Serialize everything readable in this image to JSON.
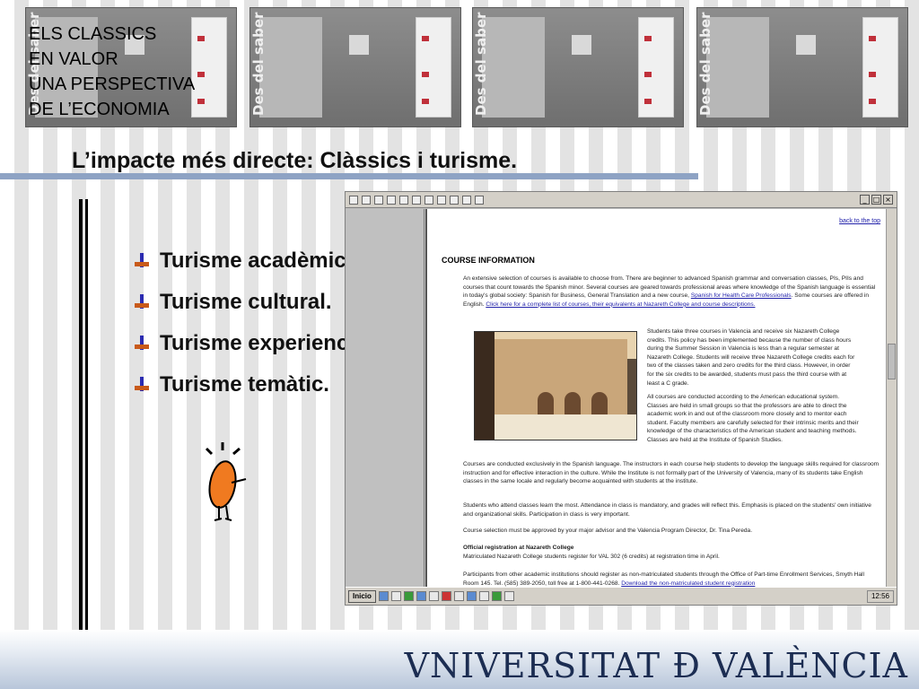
{
  "header": {
    "lines": [
      "ELS CLASSICS",
      "EN VALOR",
      "UNA PERSPECTIVA",
      "DE L’ECONOMIA"
    ]
  },
  "thumbnails": [
    {
      "caption": "Des del saber divers"
    },
    {
      "caption": "Des del saber divers"
    },
    {
      "caption": "Des del saber divers"
    },
    {
      "caption": "Des del saber divers"
    }
  ],
  "slide": {
    "title": "L’impacte més directe: Clàssics i turisme.",
    "bullets": [
      "Turisme acadèmic.",
      "Turisme cultural.",
      "Turisme experiencial.",
      "Turisme temàtic."
    ]
  },
  "browser": {
    "back_to_top": "back to the top",
    "heading": "COURSE INFORMATION",
    "p1": "An extensive selection of courses is available to choose from. There are beginner to advanced Spanish grammar and conversation classes, PIs, PIIs and courses that count towards the Spanish minor. Several courses are geared towards professional areas where knowledge of the Spanish language is essential in today's global society: Spanish for Business, General Translation and a new course,",
    "p1_link": "Spanish for Health Care Professionals",
    "p1_tail": ". Some courses are offered in English.",
    "p1_link2": "Click here for a complete list of courses, their equivalents at Nazareth College and course descriptions.",
    "p2": "Students take three courses in Valencia and receive six Nazareth College credits. This policy has been implemented because the number of class hours during the Summer Session in Valencia is less than a regular semester at Nazareth College. Students will receive three Nazareth College credits each for two of the classes taken and zero credits for the third class. However, in order for the six credits to be awarded, students must pass the third course with at least a C grade.",
    "p3": "All courses are conducted according to the American educational system. Classes are held in small groups so that the professors are able to direct the academic work in and out of the classroom more closely and to mentor each student. Faculty members are carefully selected for their intrinsic merits and their knowledge of the characteristics of the American student and teaching methods. Classes are held at the Institute of Spanish Studies.",
    "p4": "Courses are conducted exclusively in the Spanish language. The instructors in each course help students to develop the language skills required for classroom instruction and for effective interaction in the culture. While the Institute is not formally part of the University of Valencia, many of its students take English classes in the same locale and regularly become acquainted with students at the institute.",
    "p5": "Students who attend classes learn the most. Attendance in class is mandatory, and grades will reflect this. Emphasis is placed on the students' own initiative and organizational skills. Participation in class is very important.",
    "p6": "Course selection must be approved by your major advisor and the Valencia Program Director, Dr. Tina Pereda.",
    "p7_title": "Official registration at Nazareth College",
    "p7": "Matriculated Nazareth College students register for VAL 302 (6 credits) at registration time in April.",
    "p8": "Participants from other academic institutions should register as non-matriculated students through the Office of Part-time Enrollment Services, Smyth Hall Room 145. Tel. (585) 389-2050, toll free at 1-800-441-0268.",
    "p8_link": "Download the non-matriculated student registration",
    "start": "Inicio",
    "clock": "12:56"
  },
  "footer": {
    "logo": "VNIVERSITAT Ð VALÈNCIA"
  }
}
